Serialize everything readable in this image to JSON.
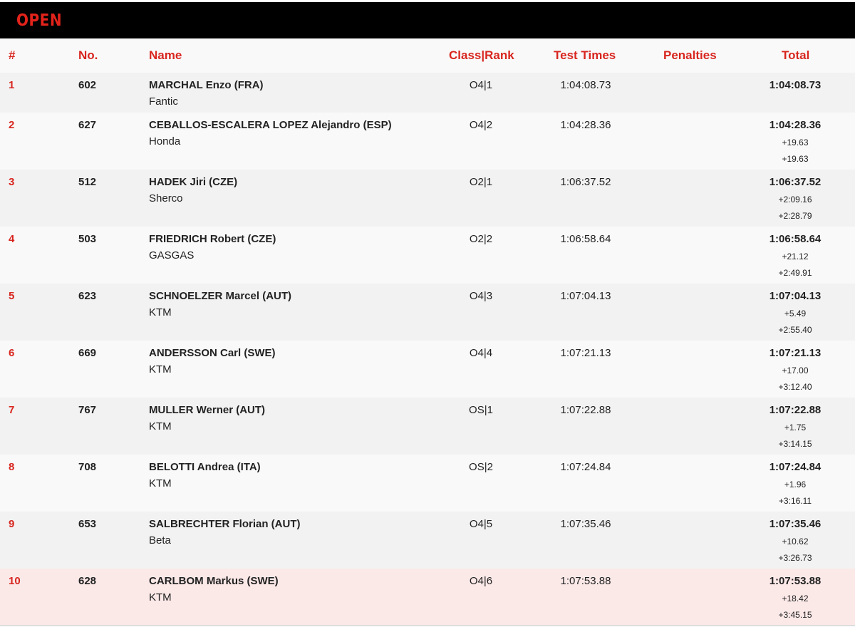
{
  "banner": {
    "title": "OPEN"
  },
  "columns": {
    "pos": "#",
    "number": "No.",
    "name": "Name",
    "class_rank": "Class|Rank",
    "test_times": "Test Times",
    "penalties": "Penalties",
    "total": "Total"
  },
  "rows": [
    {
      "pos": "1",
      "number": "602",
      "name": "MARCHAL Enzo (FRA)",
      "brand": "Fantic",
      "class_rank": "O4|1",
      "test_time": "1:04:08.73",
      "penalties": "",
      "total": "1:04:08.73",
      "gap_prev": "",
      "gap_leader": ""
    },
    {
      "pos": "2",
      "number": "627",
      "name": "CEBALLOS-ESCALERA LOPEZ Alejandro (ESP)",
      "brand": "Honda",
      "class_rank": "O4|2",
      "test_time": "1:04:28.36",
      "penalties": "",
      "total": "1:04:28.36",
      "gap_prev": "+19.63",
      "gap_leader": "+19.63"
    },
    {
      "pos": "3",
      "number": "512",
      "name": "HADEK Jiri (CZE)",
      "brand": "Sherco",
      "class_rank": "O2|1",
      "test_time": "1:06:37.52",
      "penalties": "",
      "total": "1:06:37.52",
      "gap_prev": "+2:09.16",
      "gap_leader": "+2:28.79"
    },
    {
      "pos": "4",
      "number": "503",
      "name": "FRIEDRICH Robert (CZE)",
      "brand": "GASGAS",
      "class_rank": "O2|2",
      "test_time": "1:06:58.64",
      "penalties": "",
      "total": "1:06:58.64",
      "gap_prev": "+21.12",
      "gap_leader": "+2:49.91"
    },
    {
      "pos": "5",
      "number": "623",
      "name": "SCHNOELZER Marcel (AUT)",
      "brand": "KTM",
      "class_rank": "O4|3",
      "test_time": "1:07:04.13",
      "penalties": "",
      "total": "1:07:04.13",
      "gap_prev": "+5.49",
      "gap_leader": "+2:55.40"
    },
    {
      "pos": "6",
      "number": "669",
      "name": "ANDERSSON Carl (SWE)",
      "brand": "KTM",
      "class_rank": "O4|4",
      "test_time": "1:07:21.13",
      "penalties": "",
      "total": "1:07:21.13",
      "gap_prev": "+17.00",
      "gap_leader": "+3:12.40"
    },
    {
      "pos": "7",
      "number": "767",
      "name": "MULLER Werner (AUT)",
      "brand": "KTM",
      "class_rank": "OS|1",
      "test_time": "1:07:22.88",
      "penalties": "",
      "total": "1:07:22.88",
      "gap_prev": "+1.75",
      "gap_leader": "+3:14.15"
    },
    {
      "pos": "8",
      "number": "708",
      "name": "BELOTTI Andrea (ITA)",
      "brand": "KTM",
      "class_rank": "OS|2",
      "test_time": "1:07:24.84",
      "penalties": "",
      "total": "1:07:24.84",
      "gap_prev": "+1.96",
      "gap_leader": "+3:16.11"
    },
    {
      "pos": "9",
      "number": "653",
      "name": "SALBRECHTER Florian (AUT)",
      "brand": "Beta",
      "class_rank": "O4|5",
      "test_time": "1:07:35.46",
      "penalties": "",
      "total": "1:07:35.46",
      "gap_prev": "+10.62",
      "gap_leader": "+3:26.73"
    },
    {
      "pos": "10",
      "number": "628",
      "name": "CARLBOM Markus (SWE)",
      "brand": "KTM",
      "class_rank": "O4|6",
      "test_time": "1:07:53.88",
      "penalties": "",
      "total": "1:07:53.88",
      "gap_prev": "+18.42",
      "gap_leader": "+3:45.15"
    }
  ],
  "colors": {
    "accent": "#d8261f",
    "banner_bg": "#000000",
    "row_alt": "#f2f2f2",
    "row_highlight": "#fbe9e8"
  }
}
